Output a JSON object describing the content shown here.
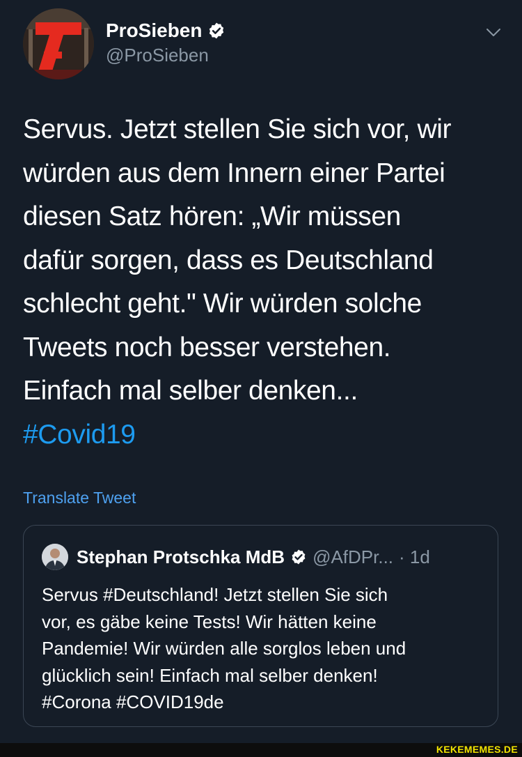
{
  "author": {
    "display_name": "ProSieben",
    "handle": "@ProSieben",
    "avatar_icon": "prosieben-logo-icon",
    "verified_icon": "verified-badge-icon"
  },
  "tweet": {
    "text": "Servus. Jetzt stellen Sie sich vor, wir\nwürden aus dem Innern einer Partei\ndiesen Satz hören: „Wir müssen\ndafür sorgen, dass es Deutschland\nschlecht geht.\" Wir würden solche\nTweets noch besser verstehen.\nEinfach mal selber denken...\n",
    "hashtag": "#Covid19",
    "translate_label": "Translate Tweet"
  },
  "quoted_tweet": {
    "display_name": "Stephan Protschka MdB",
    "handle": "@AfDPr...",
    "time": "· 1d",
    "text": "Servus #Deutschland! Jetzt stellen Sie sich\nvor, es gäbe keine Tests! Wir hätten keine\nPandemie! Wir würden alle sorglos leben und\nglücklich sein! Einfach mal selber denken!\n#Corona #COVID19de"
  },
  "watermark": "KEKEMEMES.DE",
  "colors": {
    "background": "#151d28",
    "link": "#1d9bf0",
    "muted": "#8b98a5",
    "watermark": "#f2e400"
  }
}
